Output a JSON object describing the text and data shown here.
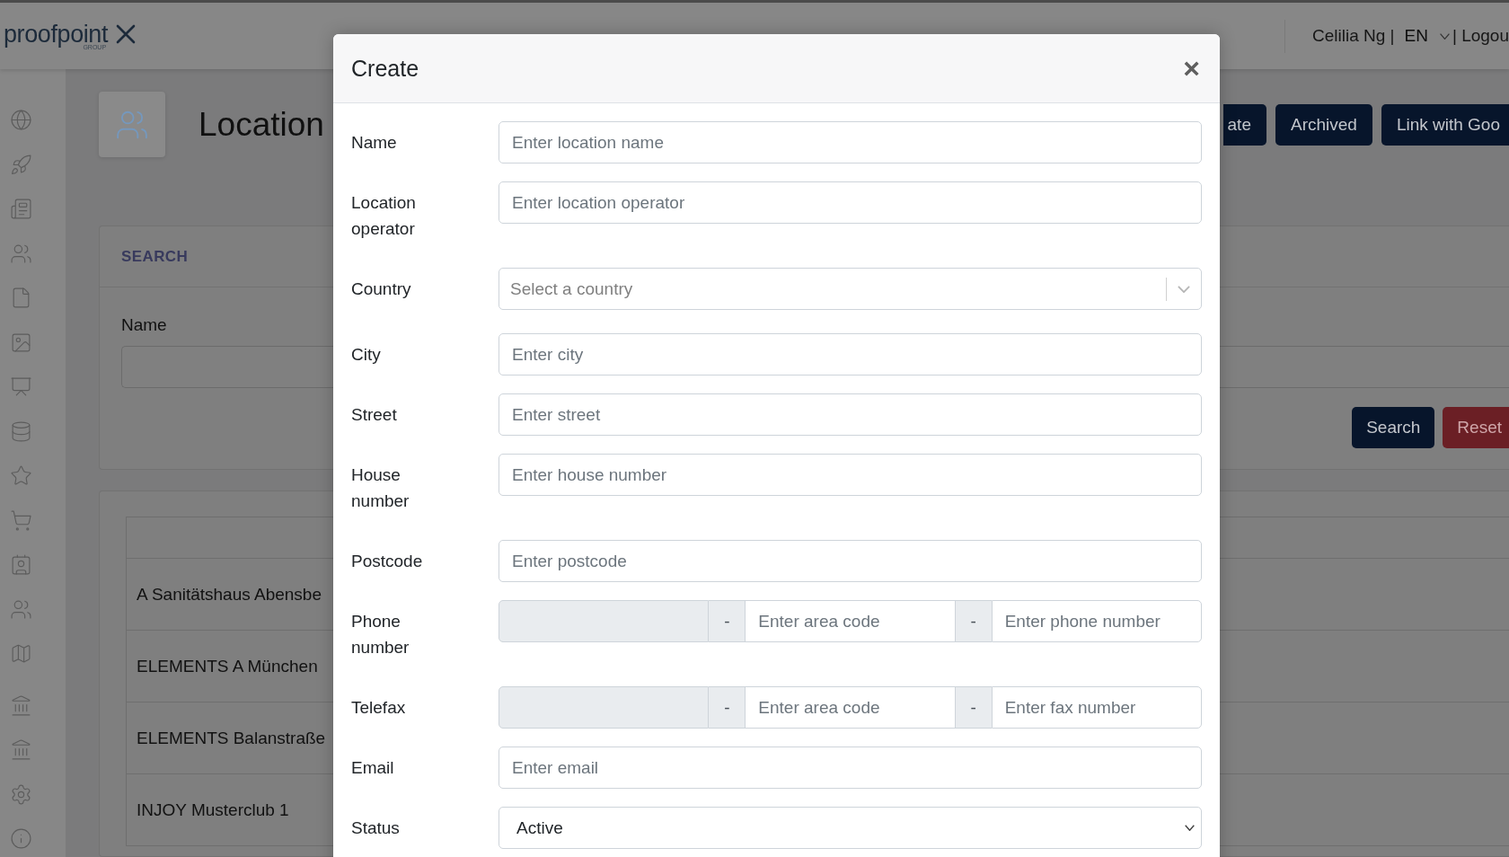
{
  "header": {
    "logo": "proofpoint",
    "logo_subtitle": "GROUP",
    "user": "Celilia Ng |",
    "language": "EN",
    "logout": "| Logou"
  },
  "page": {
    "title": "Location",
    "actions": [
      "ate",
      "Archived",
      "Link with Goo"
    ]
  },
  "search": {
    "title": "SEARCH",
    "field_label": "Name",
    "buttons": [
      {
        "label": "Search",
        "kind": "primary"
      },
      {
        "label": "Reset",
        "kind": "danger"
      }
    ]
  },
  "table": {
    "rows": [
      "A Sanitätshaus Abensbe",
      "ELEMENTS A München",
      "ELEMENTS Balanstraße",
      "INJOY Musterclub 1"
    ]
  },
  "modal": {
    "title": "Create",
    "close": "×",
    "fields": [
      {
        "label": "Name",
        "kind": "text",
        "placeholder": "Enter location name"
      },
      {
        "label": "Location operator",
        "kind": "text",
        "placeholder": "Enter location operator"
      },
      {
        "label": "Country",
        "kind": "combobox",
        "placeholder": "Select a country"
      },
      {
        "label": "City",
        "kind": "text",
        "placeholder": "Enter city"
      },
      {
        "label": "Street",
        "kind": "text",
        "placeholder": "Enter street"
      },
      {
        "label": "House number",
        "kind": "text",
        "placeholder": "Enter house number"
      },
      {
        "label": "Postcode",
        "kind": "text",
        "placeholder": "Enter postcode"
      },
      {
        "label": "Phone number",
        "kind": "group",
        "parts": [
          {
            "kind": "input",
            "disabled": true
          },
          {
            "kind": "addon",
            "text": "-"
          },
          {
            "kind": "input",
            "disabled": false,
            "placeholder": "Enter area code"
          },
          {
            "kind": "addon",
            "text": "-"
          },
          {
            "kind": "input",
            "disabled": false,
            "placeholder": "Enter phone number"
          }
        ]
      },
      {
        "label": "Telefax",
        "kind": "group",
        "parts": [
          {
            "kind": "input",
            "disabled": true
          },
          {
            "kind": "addon",
            "text": "-"
          },
          {
            "kind": "input",
            "disabled": false,
            "placeholder": "Enter area code"
          },
          {
            "kind": "addon",
            "text": "-"
          },
          {
            "kind": "input",
            "disabled": false,
            "placeholder": "Enter fax number"
          }
        ]
      },
      {
        "label": "Email",
        "kind": "text",
        "placeholder": "Enter email"
      },
      {
        "label": "Status",
        "kind": "select",
        "value": "Active"
      }
    ]
  }
}
